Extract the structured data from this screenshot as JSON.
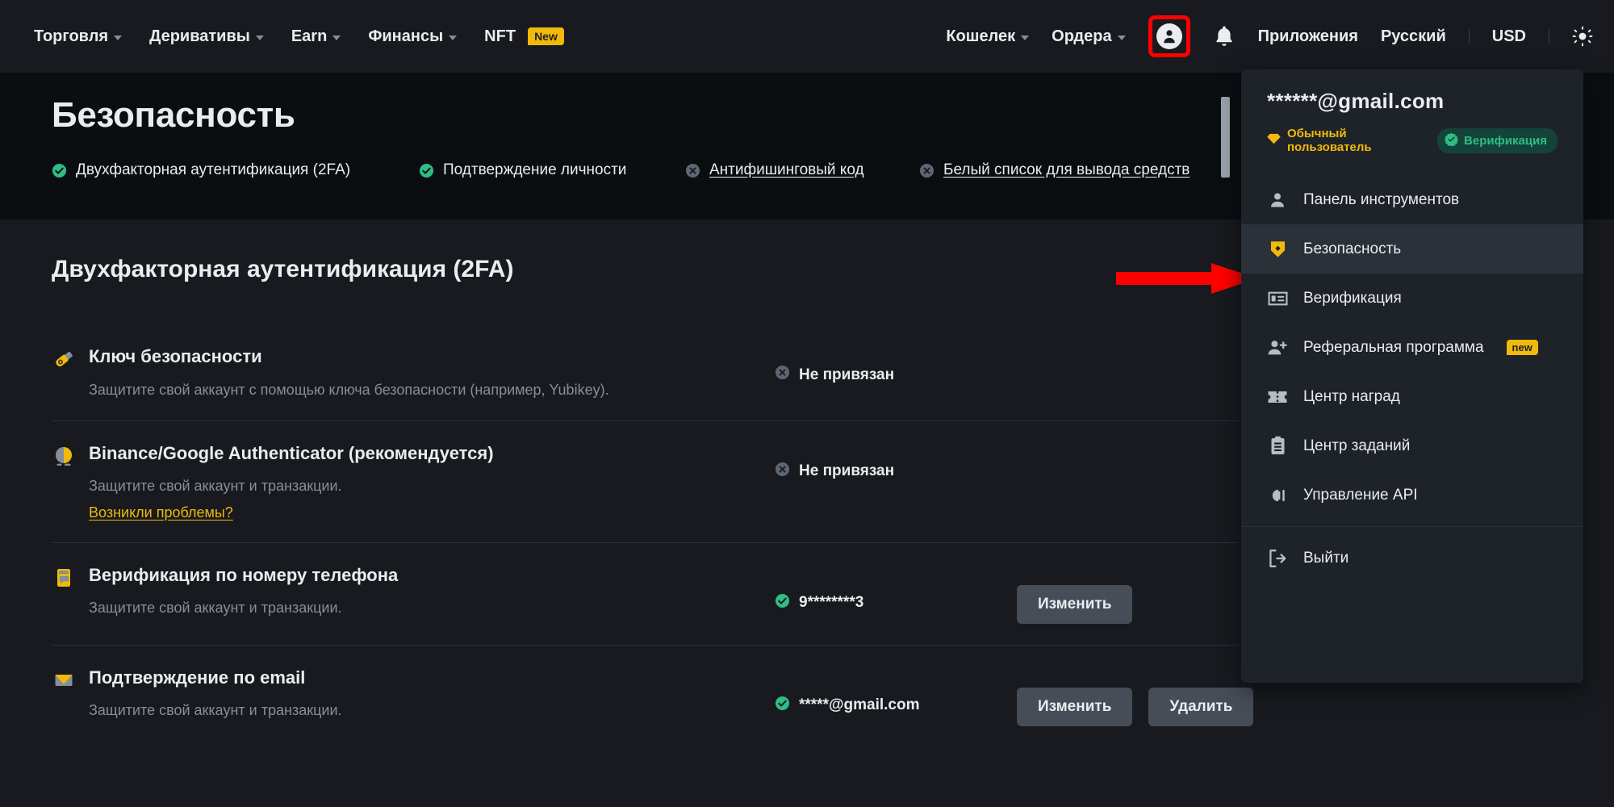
{
  "topnav": {
    "left_items": [
      {
        "label": "Торговля",
        "caret": true,
        "badge": null
      },
      {
        "label": "Деривативы",
        "caret": true,
        "badge": null
      },
      {
        "label": "Earn",
        "caret": true,
        "badge": null
      },
      {
        "label": "Финансы",
        "caret": true,
        "badge": null
      },
      {
        "label": "NFT",
        "caret": false,
        "badge": "New"
      }
    ],
    "right_items": [
      {
        "label": "Кошелек",
        "caret": true
      },
      {
        "label": "Ордера",
        "caret": true
      }
    ],
    "apps_label": "Приложения",
    "language_label": "Русский",
    "currency_label": "USD",
    "avatar_icon": "user-avatar-icon",
    "bell_icon": "notification-bell-icon",
    "theme_icon": "theme-sun-icon",
    "highlight_color": "#ff0000"
  },
  "header": {
    "title": "Безопасность",
    "status_items": [
      {
        "label": "Двухфакторная аутентификация (2FA)",
        "state": "ok",
        "icon": "check-circle-icon",
        "link": false
      },
      {
        "label": "Подтверждение личности",
        "state": "ok",
        "icon": "check-circle-icon",
        "link": false
      },
      {
        "label": "Антифишинговый код",
        "state": "off",
        "icon": "cross-circle-icon",
        "link": true
      },
      {
        "label": "Белый список для вывода средств",
        "state": "off",
        "icon": "cross-circle-icon",
        "link": true
      }
    ]
  },
  "main": {
    "section_title": "Двухфакторная аутентификация (2FA)",
    "rows": [
      {
        "icon": "security-key-icon",
        "title": "Ключ безопасности",
        "desc": "Защитите свой аккаунт с помощью ключа безопасности (например, Yubikey).",
        "link": null,
        "status_text": "Не привязан",
        "status_state": "off",
        "status_icon": "cross-circle-icon",
        "buttons": []
      },
      {
        "icon": "authenticator-icon",
        "title": "Binance/Google Authenticator (рекомендуется)",
        "desc": "Защитите свой аккаунт и транзакции.",
        "link": "Возникли проблемы?",
        "status_text": "Не привязан",
        "status_state": "off",
        "status_icon": "cross-circle-icon",
        "buttons": []
      },
      {
        "icon": "phone-verification-icon",
        "title": "Верификация по номеру телефона",
        "desc": "Защитите свой аккаунт и транзакции.",
        "link": null,
        "status_text": "9********3",
        "status_state": "ok",
        "status_icon": "check-circle-icon",
        "buttons": [
          "Изменить"
        ]
      },
      {
        "icon": "email-envelope-icon",
        "title": "Подтверждение по email",
        "desc": "Защитите свой аккаунт и транзакции.",
        "link": null,
        "status_text": "*****@gmail.com",
        "status_state": "ok",
        "status_icon": "check-circle-icon",
        "buttons": [
          "Изменить",
          "Удалить"
        ]
      }
    ]
  },
  "dropdown": {
    "email": "******@gmail.com",
    "user_tag": "Обычный пользователь",
    "verified_tag": "Верификация",
    "items": [
      {
        "label": "Панель инструментов",
        "icon": "person-icon",
        "active": false,
        "badge": null,
        "sep_after": false
      },
      {
        "label": "Безопасность",
        "icon": "shield-icon",
        "active": true,
        "badge": null,
        "sep_after": false
      },
      {
        "label": "Верификация",
        "icon": "id-card-icon",
        "active": false,
        "badge": null,
        "sep_after": false
      },
      {
        "label": "Реферальная программа",
        "icon": "person-add-icon",
        "active": false,
        "badge": "new",
        "sep_after": false
      },
      {
        "label": "Центр наград",
        "icon": "ticket-icon",
        "active": false,
        "badge": null,
        "sep_after": false
      },
      {
        "label": "Центр заданий",
        "icon": "clipboard-icon",
        "active": false,
        "badge": null,
        "sep_after": false
      },
      {
        "label": "Управление API",
        "icon": "api-plug-icon",
        "active": false,
        "badge": null,
        "sep_after": true
      },
      {
        "label": "Выйти",
        "icon": "logout-icon",
        "active": false,
        "badge": null,
        "sep_after": false
      }
    ]
  },
  "annotation": {
    "arrow_color": "#ff0000",
    "arrow_target": "Безопасность"
  },
  "colors": {
    "accent": "#f0b90b",
    "success": "#2ebd85",
    "muted": "#848e9c",
    "panel": "#1e2329",
    "bg": "#181a1f"
  }
}
